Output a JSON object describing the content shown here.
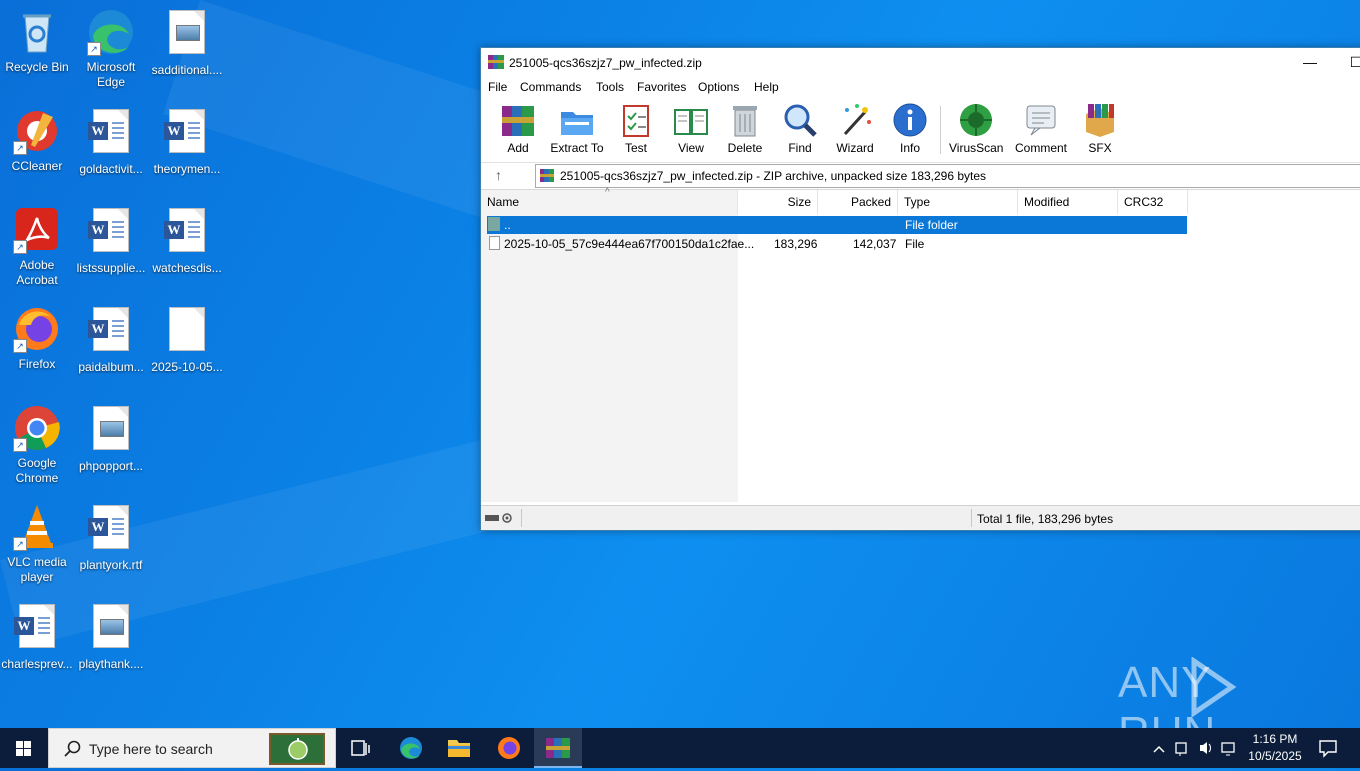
{
  "desktop": {
    "icons": [
      {
        "label": "Recycle Bin"
      },
      {
        "label": "Microsoft Edge"
      },
      {
        "label": "sadditional...."
      },
      {
        "label": "CCleaner"
      },
      {
        "label": "goldactivit..."
      },
      {
        "label": "theorymen..."
      },
      {
        "label": "Adobe Acrobat"
      },
      {
        "label": "listssupplie..."
      },
      {
        "label": "watchesdis..."
      },
      {
        "label": "Firefox"
      },
      {
        "label": "paidalbum..."
      },
      {
        "label": "2025-10-05..."
      },
      {
        "label": "Google Chrome"
      },
      {
        "label": "phpopport..."
      },
      {
        "label": "VLC media player"
      },
      {
        "label": "plantyork.rtf"
      },
      {
        "label": "charlesprev..."
      },
      {
        "label": "playthank...."
      }
    ]
  },
  "window": {
    "title": "251005-qcs36szjz7_pw_infected.zip",
    "controls": {
      "minimize": "—",
      "maximize": "☐"
    },
    "menu": [
      "File",
      "Commands",
      "Tools",
      "Favorites",
      "Options",
      "Help"
    ],
    "toolbar": [
      {
        "label": "Add",
        "icon": "add-icon"
      },
      {
        "label": "Extract To",
        "icon": "extract-icon"
      },
      {
        "label": "Test",
        "icon": "test-icon"
      },
      {
        "label": "View",
        "icon": "view-icon"
      },
      {
        "label": "Delete",
        "icon": "delete-icon"
      },
      {
        "label": "Find",
        "icon": "find-icon"
      },
      {
        "label": "Wizard",
        "icon": "wizard-icon"
      },
      {
        "label": "Info",
        "icon": "info-icon"
      },
      {
        "label": "VirusScan",
        "icon": "virusscan-icon"
      },
      {
        "label": "Comment",
        "icon": "comment-icon"
      },
      {
        "label": "SFX",
        "icon": "sfx-icon"
      }
    ],
    "address": "251005-qcs36szjz7_pw_infected.zip - ZIP archive, unpacked size 183,296 bytes",
    "columns": [
      "Name",
      "Size",
      "Packed",
      "Type",
      "Modified",
      "CRC32"
    ],
    "rows": [
      {
        "name": "..",
        "size": "",
        "packed": "",
        "type": "File folder",
        "modified": "",
        "crc": "",
        "selected": true
      },
      {
        "name": "2025-10-05_57c9e444ea67f700150da1c2fae...",
        "size": "183,296",
        "packed": "142,037",
        "type": "File",
        "modified": "",
        "crc": "",
        "selected": false
      }
    ],
    "status": "Total 1 file, 183,296 bytes"
  },
  "watermark": {
    "text_left": "ANY",
    "text_right": "RUN"
  },
  "taskbar": {
    "search_placeholder": "Type here to search",
    "clock_time": "1:16 PM",
    "clock_date": "10/5/2025"
  },
  "colors": {
    "selection": "#0b78d7",
    "taskbar": "#0b1d3a",
    "desktop": "#0b82e6"
  }
}
